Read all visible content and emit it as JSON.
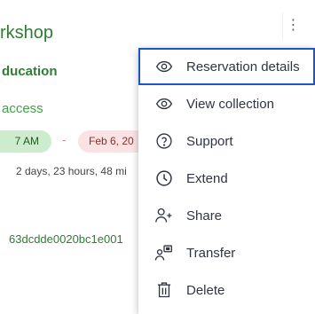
{
  "background": {
    "title": "rkshop",
    "subtitle": "ducation",
    "access_label": "access",
    "start_time": "7 AM",
    "separator": "-",
    "end_date": "Feb 6, 20",
    "duration": "2 days, 23 hours, 48 mi",
    "id_value": "63dcdde0020bc1e001",
    "more_icon": "⋮"
  },
  "menu": {
    "items": [
      {
        "label": "Reservation details",
        "icon": "eye-icon",
        "focused": true
      },
      {
        "label": "View collection",
        "icon": "eye-icon"
      },
      {
        "label": "Support",
        "icon": "help-circle-icon"
      },
      {
        "label": "Extend",
        "icon": "clock-icon"
      },
      {
        "label": "Share",
        "icon": "user-plus-icon"
      },
      {
        "label": "Transfer",
        "icon": "user-transfer-icon"
      },
      {
        "label": "Delete",
        "icon": "trash-icon"
      }
    ]
  },
  "colors": {
    "green_text": "#2e7d32",
    "focus_border": "#1a56c8",
    "start_pill_bg": "#cdeccd",
    "end_pill_bg": "#fbe3e3"
  }
}
